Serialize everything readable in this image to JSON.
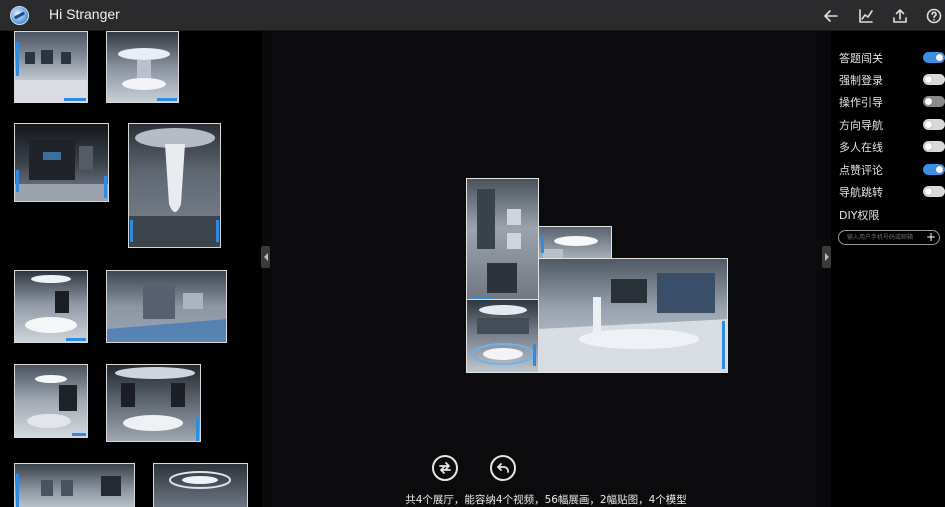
{
  "app": {
    "title": "Hi Stranger"
  },
  "toolbar": {
    "icons": [
      "back-arrow-icon",
      "chart-icon",
      "share-upload-icon",
      "help-icon"
    ]
  },
  "gallery": {
    "thumbnails": [
      {
        "name": "hall-thumb-1",
        "scene": "exhibition-hall"
      },
      {
        "name": "hall-thumb-2",
        "scene": "round-stage-hall"
      },
      {
        "name": "hall-thumb-3",
        "scene": "dark-wall-hall"
      },
      {
        "name": "hall-thumb-4",
        "scene": "pillar-hall"
      },
      {
        "name": "hall-thumb-5",
        "scene": "stage-lobby"
      },
      {
        "name": "hall-thumb-6",
        "scene": "gallery-wall"
      },
      {
        "name": "hall-thumb-7",
        "scene": "white-stage"
      },
      {
        "name": "hall-thumb-8",
        "scene": "round-platform"
      },
      {
        "name": "hall-thumb-9",
        "scene": "corridor-hall"
      },
      {
        "name": "hall-thumb-10",
        "scene": "ring-ceiling"
      }
    ]
  },
  "center": {
    "summary": "共4个展厅，能容纳4个视频，56幅展画，2幅贴图，4个模型",
    "buttons": [
      "swap-icon",
      "undo-icon"
    ]
  },
  "settings": {
    "items": [
      {
        "label": "答题闯关",
        "state": "on"
      },
      {
        "label": "强制登录",
        "state": "off"
      },
      {
        "label": "操作引导",
        "state": "disabled"
      },
      {
        "label": "方向导航",
        "state": "off"
      },
      {
        "label": "多人在线",
        "state": "off"
      },
      {
        "label": "点赞评论",
        "state": "on"
      },
      {
        "label": "导航跳转",
        "state": "off"
      }
    ],
    "diy_label": "DIY权限",
    "diy_placeholder": "输入用户手机号码或邮箱",
    "diy_add": "+"
  },
  "colors": {
    "accent": "#3a8fe0",
    "topbar": "#2b2b2d",
    "background": "#000000"
  }
}
